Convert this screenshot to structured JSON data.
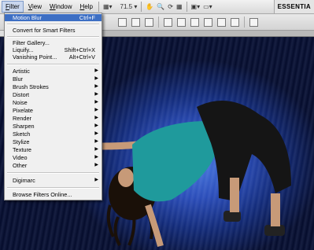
{
  "menubar": {
    "items": [
      {
        "label": "Filter",
        "underline": "F",
        "rest": "ilter",
        "active": true
      },
      {
        "label": "View",
        "underline": "V",
        "rest": "iew",
        "active": false
      },
      {
        "label": "Window",
        "underline": "W",
        "rest": "indow",
        "active": false
      },
      {
        "label": "Help",
        "underline": "H",
        "rest": "elp",
        "active": false
      }
    ],
    "zoom": "71.5",
    "workspace": "ESSENTIA"
  },
  "filter_menu": {
    "top": [
      {
        "label": "Motion Blur",
        "shortcut": "Ctrl+F",
        "highlighted": true
      }
    ],
    "smart": [
      {
        "label": "Convert for Smart Filters",
        "shortcut": ""
      }
    ],
    "gallery": [
      {
        "label": "Filter Gallery...",
        "shortcut": ""
      },
      {
        "label": "Liquify...",
        "shortcut": "Shift+Ctrl+X"
      },
      {
        "label": "Vanishing Point...",
        "shortcut": "Alt+Ctrl+V"
      }
    ],
    "categories": [
      "Artistic",
      "Blur",
      "Brush Strokes",
      "Distort",
      "Noise",
      "Pixelate",
      "Render",
      "Sharpen",
      "Sketch",
      "Stylize",
      "Texture",
      "Video",
      "Other"
    ],
    "digimarc": "Digimarc",
    "browse": "Browse Filters Online..."
  },
  "colors": {
    "highlight": "#3d6fc4",
    "shirt": "#1f9a9c",
    "background_blue": "#2a4cb8"
  }
}
